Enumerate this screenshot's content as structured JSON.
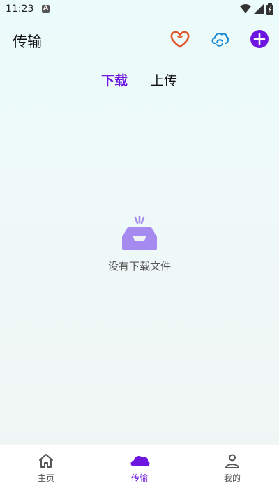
{
  "status_bar": {
    "time": "11:23",
    "notification_badge": "A"
  },
  "header": {
    "title": "传输"
  },
  "tabs": [
    {
      "label": "下载",
      "active": true
    },
    {
      "label": "上传",
      "active": false
    }
  ],
  "empty_state": {
    "message": "没有下载文件"
  },
  "bottom_nav": {
    "items": [
      {
        "label": "主页",
        "icon": "home-icon",
        "active": false
      },
      {
        "label": "传输",
        "icon": "cloud-icon",
        "active": true
      },
      {
        "label": "我的",
        "icon": "person-icon",
        "active": false
      }
    ]
  },
  "colors": {
    "accent": "#6d16e0",
    "heart": "#e0562a",
    "cloud": "#1e8ad6",
    "empty_icon": "#a58bf0"
  }
}
